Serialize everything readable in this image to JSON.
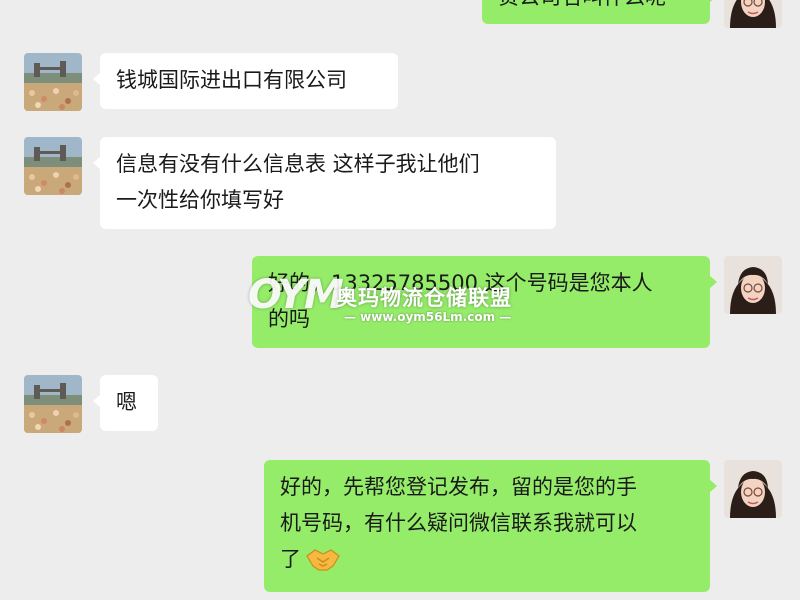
{
  "colors": {
    "background": "#ededed",
    "incoming_bubble": "#ffffff",
    "outgoing_bubble": "#95ec69",
    "text": "#1a1a1a"
  },
  "messages": [
    {
      "side": "right",
      "avatar": "woman-glasses-avatar",
      "lines": [
        "贵公司名叫什么呢"
      ],
      "partial": true
    },
    {
      "side": "left",
      "avatar": "landscape-avatar",
      "lines": [
        "钱城国际进出口有限公司"
      ]
    },
    {
      "side": "left",
      "avatar": "landscape-avatar",
      "lines": [
        "信息有没有什么信息表  这样子我让他们",
        "一次性给你填写好"
      ]
    },
    {
      "side": "right",
      "avatar": "woman-glasses-avatar",
      "lines": [
        "好的，13325785500 这个号码是您本人",
        "的吗"
      ]
    },
    {
      "side": "left",
      "avatar": "landscape-avatar",
      "lines": [
        "嗯"
      ]
    },
    {
      "side": "right",
      "avatar": "woman-glasses-avatar",
      "lines": [
        "好的，先帮您登记发布，留的是您的手",
        "机号码，有什么疑问微信联系我就可以",
        "了"
      ],
      "emoji": "handshake-emoji"
    }
  ],
  "watermark": {
    "logo": "OYM",
    "title": "奥玛物流仓储联盟",
    "url": "— www.oym56Lm.com —"
  }
}
